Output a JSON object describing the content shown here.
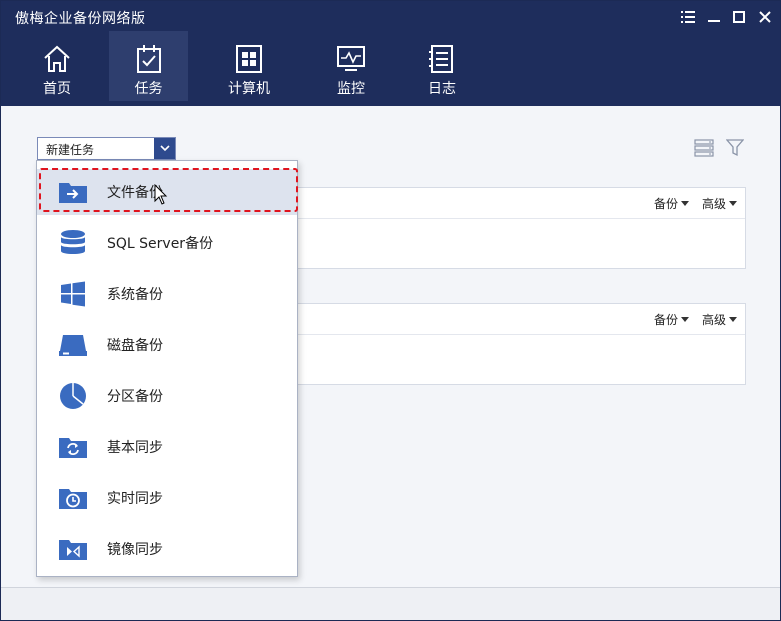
{
  "app": {
    "title": "傲梅企业备份网络版"
  },
  "window_controls": [
    "menu-icon",
    "minimize-icon",
    "maximize-icon",
    "close-icon"
  ],
  "nav": [
    {
      "label": "首页",
      "icon": "home-icon"
    },
    {
      "label": "任务",
      "icon": "task-icon",
      "active": true
    },
    {
      "label": "计算机",
      "icon": "computer-icon"
    },
    {
      "label": "监控",
      "icon": "monitor-icon"
    },
    {
      "label": "日志",
      "icon": "log-icon"
    }
  ],
  "toolbar": {
    "new_task_label": "新建任务",
    "list_icon": "list-view-icon",
    "filter_icon": "filter-icon"
  },
  "task_cards": [
    {
      "backup_label": "备份",
      "advanced_label": "高级"
    },
    {
      "backup_label": "备份",
      "advanced_label": "高级"
    }
  ],
  "dropdown": {
    "items": [
      {
        "label": "文件备份",
        "icon": "folder-arrow-icon",
        "selected": true
      },
      {
        "label": "SQL Server备份",
        "icon": "database-icon"
      },
      {
        "label": "系统备份",
        "icon": "windows-icon"
      },
      {
        "label": "磁盘备份",
        "icon": "disk-icon"
      },
      {
        "label": "分区备份",
        "icon": "pie-icon"
      },
      {
        "label": "基本同步",
        "icon": "folder-sync-icon"
      },
      {
        "label": "实时同步",
        "icon": "folder-clock-icon"
      },
      {
        "label": "镜像同步",
        "icon": "folder-mirror-icon"
      }
    ]
  },
  "colors": {
    "header": "#1e2d5c",
    "nav_active": "#2e3e6e",
    "accent": "#2e5fa8",
    "highlight_border": "#e0141e"
  }
}
